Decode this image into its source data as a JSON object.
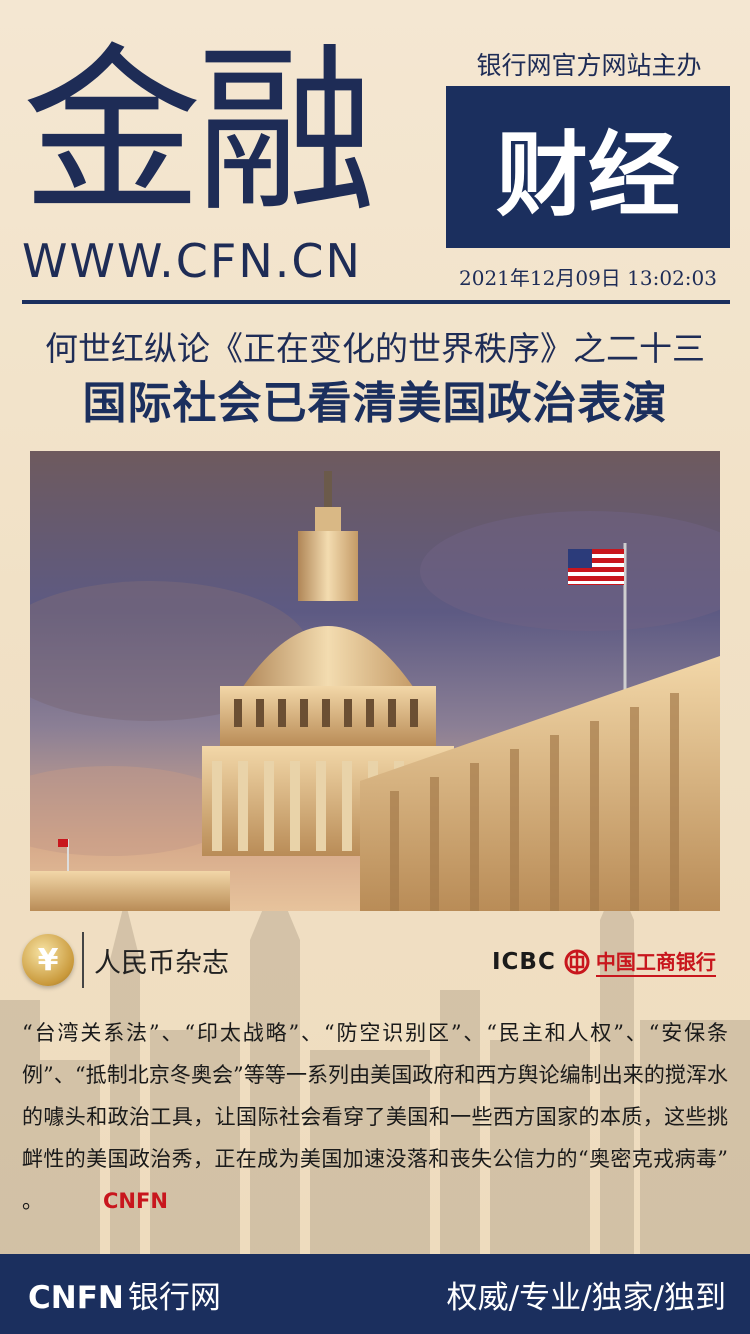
{
  "header": {
    "logo_main": "金融",
    "logo_url": "WWW.CFN.CN",
    "host": "银行网官方网站主办",
    "section": "财经",
    "datetime": "2021年12月09日  13:02:03"
  },
  "article": {
    "series": "何世红纵论《正在变化的世界秩序》之二十三",
    "headline": "国际社会已看清美国政治表演",
    "image_icon": "capitol-building-photo",
    "source_icon": "yuan-coin-icon",
    "source": "人民币杂志",
    "sponsor_en": "ICBC",
    "sponsor_cn": "中国工商银行",
    "body": "“台湾关系法”、“印太战略”、“防空识别区”、“民主和人权”、“安保条例”、“抵制北京冬奥会”等等一系列由美国政府和西方舆论编制出来的搅浑水的噱头和政治工具，让国际社会看穿了美国和一些西方国家的本质，这些挑衅性的美国政治秀，正在成为美国加速没落和丧失公信力的“奥密克戎病毒” 。",
    "signature": "CNFN"
  },
  "footer": {
    "brand_en": "CNFN",
    "brand_cn": "银行网",
    "slogan": "权威/专业/独家/独到"
  },
  "colors": {
    "navy": "#1b2f5e",
    "red": "#c8161d",
    "background": "#f2e3c9"
  }
}
